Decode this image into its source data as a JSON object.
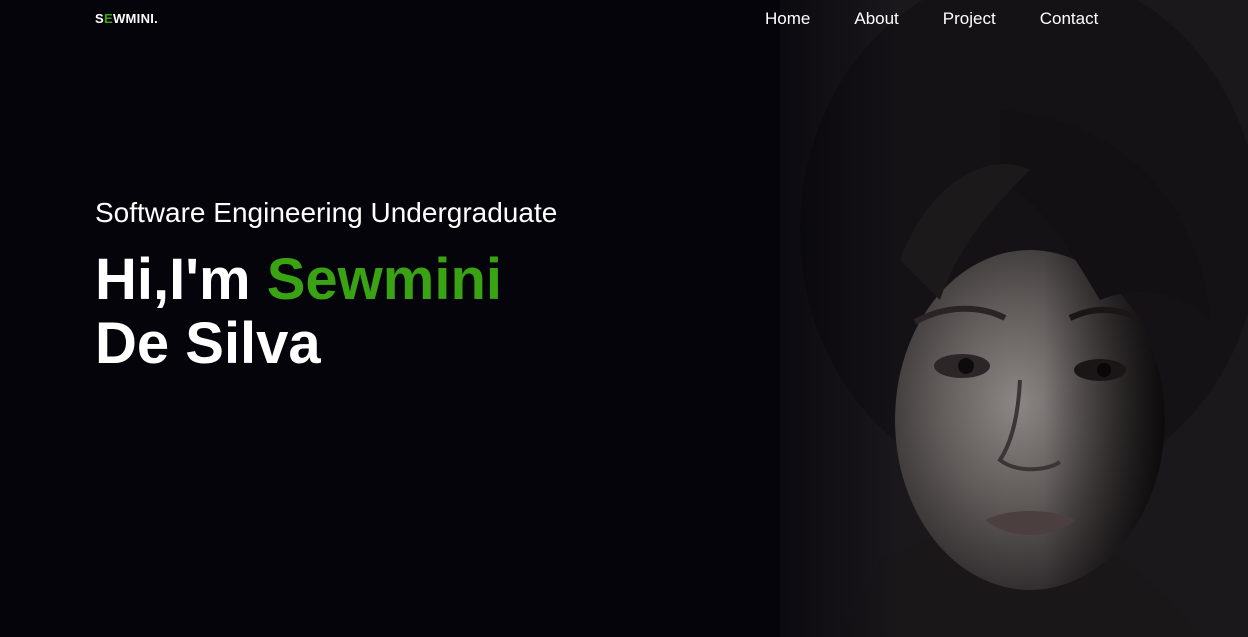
{
  "brand": {
    "logo_first": "S",
    "logo_accent": "E",
    "logo_rest": "WMINI.",
    "accent_color": "#3aa313"
  },
  "nav": {
    "items": [
      {
        "label": "Home"
      },
      {
        "label": "About"
      },
      {
        "label": "Project"
      },
      {
        "label": "Contact"
      }
    ]
  },
  "hero": {
    "subtitle": "Software Engineering Undergraduate",
    "greeting": "Hi,I'm ",
    "first_name": "Sewmini",
    "last_name": "De Silva"
  },
  "colors": {
    "background": "#05040b",
    "text": "#ffffff",
    "accent": "#3aa313"
  }
}
